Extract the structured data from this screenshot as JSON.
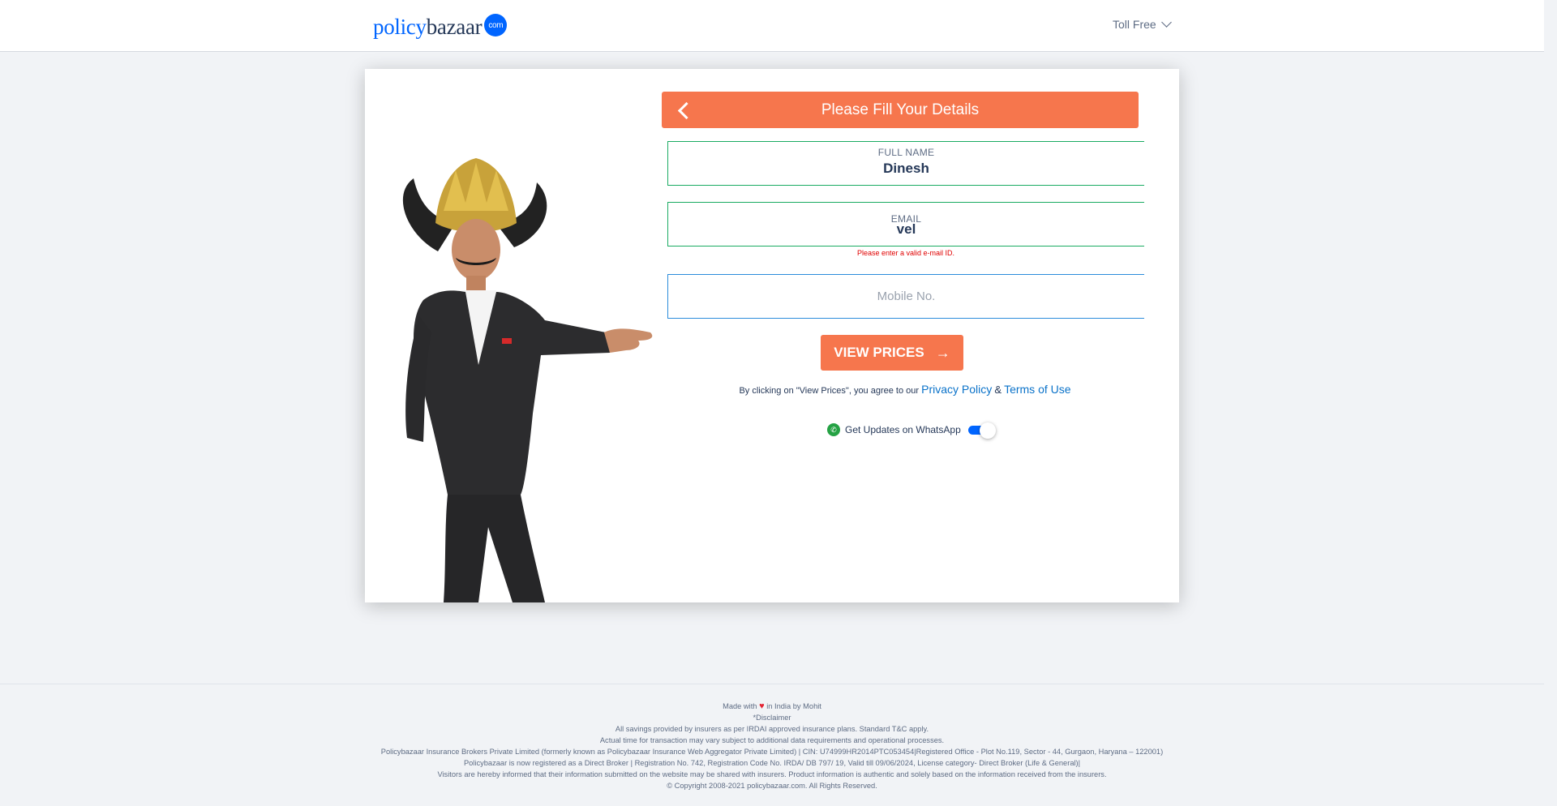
{
  "header": {
    "logo_part1": "policy",
    "logo_part2": "bazaar",
    "logo_com": "com",
    "toll_free": "Toll Free"
  },
  "form": {
    "title": "Please Fill Your Details",
    "full_name": {
      "label": "FULL NAME",
      "value": "Dinesh"
    },
    "email": {
      "label": "EMAIL",
      "value": "vel",
      "error": "Please enter a valid e-mail ID."
    },
    "mobile": {
      "placeholder": "Mobile No."
    },
    "view_prices": "VIEW PRICES",
    "arrow": "→",
    "agree_text": "By clicking on \"View Prices\", you agree to our",
    "privacy": "Privacy Policy",
    "amp": "&",
    "terms": "Terms of Use",
    "whatsapp": "Get Updates on WhatsApp",
    "whatsapp_on": true
  },
  "footer": {
    "made_with": "Made with",
    "made_by": "in India by Mohit",
    "disclaimer": "*Disclaimer",
    "line1": "All savings provided by insurers as per IRDAI approved insurance plans. Standard T&C apply.",
    "line2": "Actual time for transaction may vary subject to additional data requirements and operational processes.",
    "line3": "Policybazaar Insurance Brokers Private Limited (formerly known as Policybazaar Insurance Web Aggregator Private Limited) | CIN: U74999HR2014PTC053454|Registered Office - Plot No.119, Sector - 44, Gurgaon, Haryana – 122001)",
    "line4": "Policybazaar is now registered as a Direct Broker | Registration No. 742, Registration Code No. IRDA/ DB 797/ 19, Valid till 09/06/2024, License category- Direct Broker (Life & General)|",
    "line5": "Visitors are hereby informed that their information submitted on the website may be shared with insurers. Product information is authentic and solely based on the information received from the insurers.",
    "copyright": "© Copyright 2008-2021 policybazaar.com. All Rights Reserved."
  },
  "colors": {
    "accent": "#f6764d",
    "brand_blue": "#0065ff",
    "valid_green": "#1aab62",
    "error_red": "#e00000"
  }
}
